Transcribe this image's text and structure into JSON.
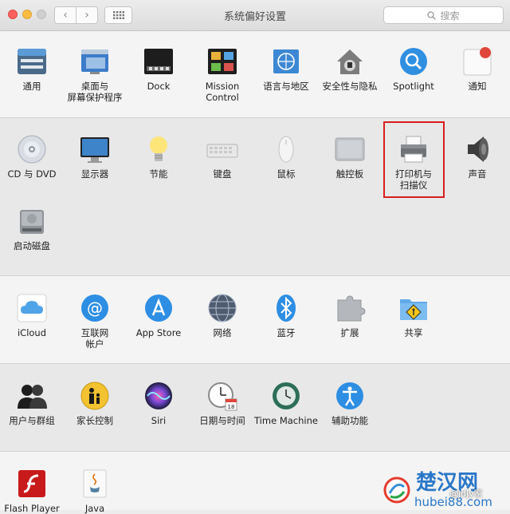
{
  "window": {
    "title": "系统偏好设置",
    "search_placeholder": "搜索"
  },
  "sections": [
    {
      "items": [
        {
          "id": "general",
          "label": "通用",
          "icon": "general-icon"
        },
        {
          "id": "desktop",
          "label": "桌面与\n屏幕保护程序",
          "icon": "desktop-icon"
        },
        {
          "id": "dock",
          "label": "Dock",
          "icon": "dock-icon"
        },
        {
          "id": "mission",
          "label": "Mission\nControl",
          "icon": "mission-control-icon"
        },
        {
          "id": "language",
          "label": "语言与地区",
          "icon": "globe-flag-icon"
        },
        {
          "id": "security",
          "label": "安全性与隐私",
          "icon": "house-lock-icon"
        },
        {
          "id": "spotlight",
          "label": "Spotlight",
          "icon": "magnifier-icon"
        },
        {
          "id": "notifications",
          "label": "通知",
          "icon": "notifications-icon"
        }
      ]
    },
    {
      "items": [
        {
          "id": "cd",
          "label": "CD 与 DVD",
          "icon": "cd-icon"
        },
        {
          "id": "displays",
          "label": "显示器",
          "icon": "display-icon"
        },
        {
          "id": "energy",
          "label": "节能",
          "icon": "lightbulb-icon"
        },
        {
          "id": "keyboard",
          "label": "键盘",
          "icon": "keyboard-icon"
        },
        {
          "id": "mouse",
          "label": "鼠标",
          "icon": "mouse-icon"
        },
        {
          "id": "trackpad",
          "label": "触控板",
          "icon": "trackpad-icon"
        },
        {
          "id": "printers",
          "label": "打印机与\n扫描仪",
          "icon": "printer-icon"
        },
        {
          "id": "sound",
          "label": "声音",
          "icon": "speaker-icon"
        },
        {
          "id": "startup",
          "label": "启动磁盘",
          "icon": "hard-disk-icon"
        }
      ]
    },
    {
      "items": [
        {
          "id": "icloud",
          "label": "iCloud",
          "icon": "cloud-icon"
        },
        {
          "id": "internet",
          "label": "互联网\n帐户",
          "icon": "at-sign-icon"
        },
        {
          "id": "appstore",
          "label": "App Store",
          "icon": "app-store-icon"
        },
        {
          "id": "network",
          "label": "网络",
          "icon": "network-globe-icon"
        },
        {
          "id": "bluetooth",
          "label": "蓝牙",
          "icon": "bluetooth-icon"
        },
        {
          "id": "extensions",
          "label": "扩展",
          "icon": "puzzle-icon"
        },
        {
          "id": "sharing",
          "label": "共享",
          "icon": "sharing-folder-icon"
        }
      ]
    },
    {
      "items": [
        {
          "id": "users",
          "label": "用户与群组",
          "icon": "users-icon"
        },
        {
          "id": "parental",
          "label": "家长控制",
          "icon": "parental-icon"
        },
        {
          "id": "siri",
          "label": "Siri",
          "icon": "siri-icon"
        },
        {
          "id": "datetime",
          "label": "日期与时间",
          "icon": "clock-calendar-icon"
        },
        {
          "id": "timemachine",
          "label": "Time Machine",
          "icon": "time-machine-icon"
        },
        {
          "id": "accessibility",
          "label": "辅助功能",
          "icon": "accessibility-icon"
        }
      ]
    },
    {
      "items": [
        {
          "id": "flash",
          "label": "Flash Player",
          "icon": "flash-icon"
        },
        {
          "id": "java",
          "label": "Java",
          "icon": "java-icon"
        }
      ]
    }
  ],
  "watermark": {
    "logo_text": "楚汉网",
    "url_text": "hubei88.com",
    "overlay_text": "@jdjy家"
  }
}
